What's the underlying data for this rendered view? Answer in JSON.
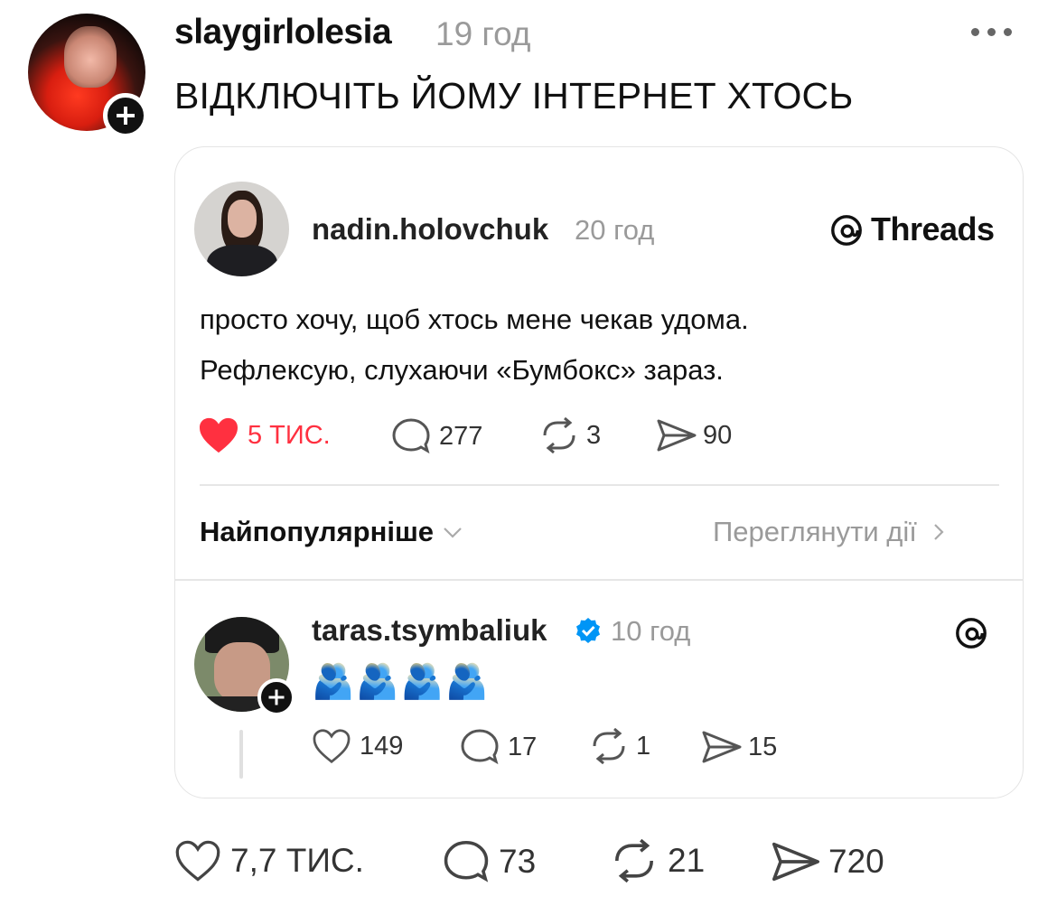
{
  "post": {
    "username": "slaygirlolesia",
    "time": "19 год",
    "text": "ВІДКЛЮЧІТЬ ЙОМУ ІНТЕРНЕТ ХТОСЬ",
    "actions": {
      "likes": "7,7 ТИС.",
      "comments": "73",
      "reposts": "21",
      "shares": "720"
    }
  },
  "quoted": {
    "username": "nadin.holovchuk",
    "time": "20 год",
    "brand": "Threads",
    "text_line1": "просто хочу, щоб хтось мене чекав удома.",
    "text_line2": "Рефлексую, слухаючи «Бумбокс» зараз.",
    "actions": {
      "likes": "5 ТИС.",
      "comments": "277",
      "reposts": "3",
      "shares": "90"
    },
    "sort_label": "Найпопулярніше",
    "view_activity": "Переглянути дії",
    "reply": {
      "username": "taras.tsymbaliuk",
      "time": "10 год",
      "emoji": "🫂🫂🫂🫂",
      "actions": {
        "likes": "149",
        "comments": "17",
        "reposts": "1",
        "shares": "15"
      }
    }
  },
  "colors": {
    "like_red": "#ff3040",
    "verified_blue": "#0095f6",
    "muted": "#9a9a9a"
  }
}
